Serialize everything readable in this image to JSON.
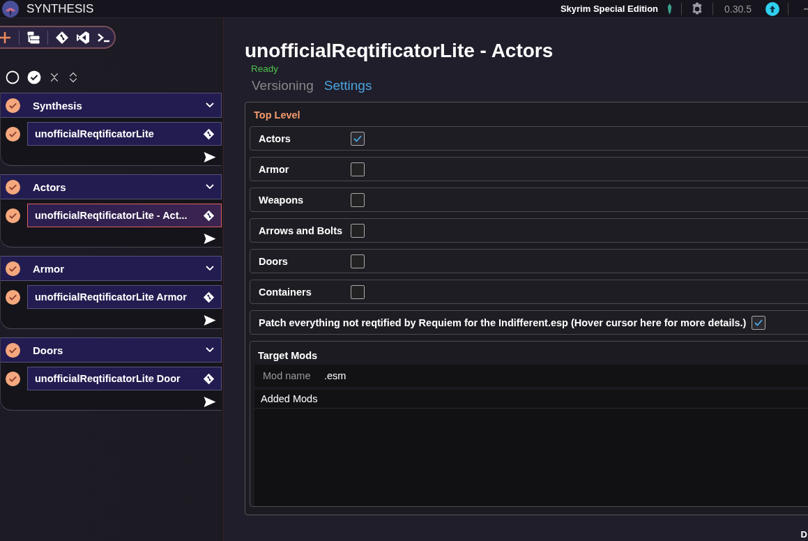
{
  "window": {
    "title": "SYNTHESIS",
    "game": "Skyrim Special Edition",
    "version": "0.30.5"
  },
  "groups": [
    {
      "name": "Synthesis",
      "checked": true,
      "patchers": [
        {
          "name": "unofficialReqtificatorLite",
          "checked": true,
          "selected": false
        }
      ]
    },
    {
      "name": "Actors",
      "checked": true,
      "patchers": [
        {
          "name": "unofficialReqtificatorLite - Act...",
          "checked": true,
          "selected": true
        }
      ]
    },
    {
      "name": "Armor",
      "checked": true,
      "patchers": [
        {
          "name": "unofficialReqtificatorLite Armor",
          "checked": true,
          "selected": false
        }
      ]
    },
    {
      "name": "Doors",
      "checked": true,
      "patchers": [
        {
          "name": "unofficialReqtificatorLite Door",
          "checked": true,
          "selected": false
        }
      ]
    }
  ],
  "patcher": {
    "title": "unofficialReqtificatorLite - Actors",
    "status": "Ready",
    "tabs": [
      {
        "label": "Versioning",
        "selected": false
      },
      {
        "label": "Settings",
        "selected": true
      }
    ],
    "section": "Top Level",
    "settings": [
      {
        "label": "Actors",
        "checked": true
      },
      {
        "label": "Armor",
        "checked": false
      },
      {
        "label": "Weapons",
        "checked": false
      },
      {
        "label": "Arrows and Bolts",
        "checked": false
      },
      {
        "label": "Doors",
        "checked": false
      },
      {
        "label": "Containers",
        "checked": false
      },
      {
        "label": "Patch everything not reqtified by Requiem for the Indifferent.esp (Hover cursor here for more details.)",
        "checked": true
      }
    ],
    "target_mods": {
      "title": "Target Mods",
      "placeholder": "Mod name",
      "suffix": ".esm",
      "list_header": "Added Mods"
    }
  },
  "footer_text": "D"
}
